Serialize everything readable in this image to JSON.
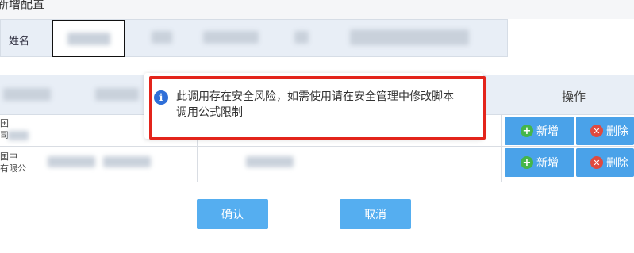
{
  "dialog": {
    "title": "新增配置"
  },
  "form": {
    "name_label": "姓名"
  },
  "grid": {
    "ops_header": "操作",
    "rows": [
      {
        "text_line1": "国",
        "text_line2": "司"
      },
      {
        "text_line1": "国中",
        "text_line2": "有限公"
      }
    ]
  },
  "row_buttons": {
    "add_label": "新增",
    "delete_label": "删除"
  },
  "footer": {
    "confirm_label": "确认",
    "cancel_label": "取消"
  },
  "alert": {
    "icon": "info-icon",
    "message_line1": "此调用存在安全风险，如需使用请在安全管理中修改脚本",
    "message_line2": "调用公式限制"
  },
  "colors": {
    "accent": "#4aa2e9",
    "alert_border": "#e3241b",
    "info_icon": "#2f6fd8",
    "add_icon": "#45b649",
    "delete_icon": "#e04a3f"
  }
}
